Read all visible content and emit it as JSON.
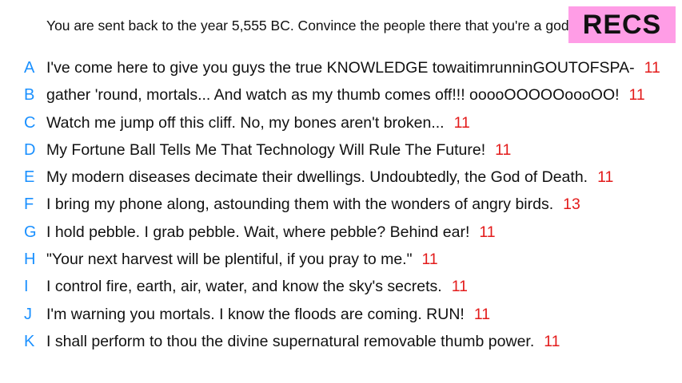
{
  "prompt": "You are sent back to the year 5,555 BC. Convince the people there that you're a god.",
  "badge": {
    "label": "RECS",
    "color": "#ff9de6"
  },
  "colors": {
    "letter": "#1a90ff",
    "score": "#e31b1b",
    "text": "#111111"
  },
  "items": [
    {
      "letter": "A",
      "text": "I've come here to give you guys the true KNOWLEDGE towaitimrunninGOUTOFSPA-",
      "score": "11"
    },
    {
      "letter": "B",
      "text": "gather 'round, mortals... And watch as my thumb comes off!!! ooooOOOOOoooOO!",
      "score": "11"
    },
    {
      "letter": "C",
      "text": "Watch me jump off this cliff. No, my bones aren't broken...",
      "score": "11"
    },
    {
      "letter": "D",
      "text": "My Fortune Ball Tells Me That Technology Will Rule The Future!",
      "score": "11"
    },
    {
      "letter": "E",
      "text": "My modern diseases decimate their dwellings. Undoubtedly, the God of Death.",
      "score": "11"
    },
    {
      "letter": "F",
      "text": "I bring my phone along, astounding them with the wonders of angry birds.",
      "score": "13"
    },
    {
      "letter": "G",
      "text": "I hold pebble. I grab pebble. Wait, where pebble? Behind ear!",
      "score": "11"
    },
    {
      "letter": "H",
      "text": "\"Your next harvest will be plentiful, if you pray to me.\"",
      "score": "11"
    },
    {
      "letter": "I",
      "text": "I control fire, earth, air, water, and know the sky's secrets.",
      "score": "11"
    },
    {
      "letter": "J",
      "text": "I'm warning you mortals. I know the floods are coming. RUN!",
      "score": "11"
    },
    {
      "letter": "K",
      "text": "I shall perform to thou the divine supernatural removable thumb power.",
      "score": "11"
    }
  ]
}
